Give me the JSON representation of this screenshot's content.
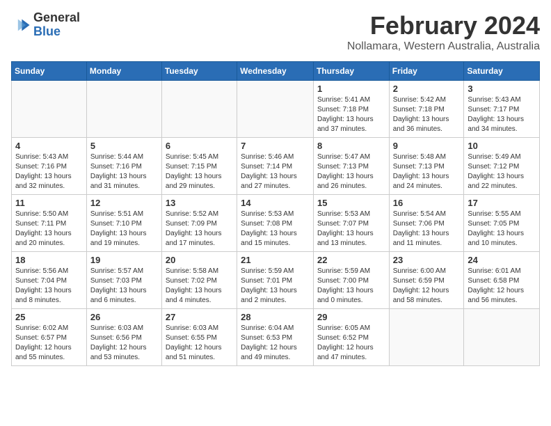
{
  "logo": {
    "general": "General",
    "blue": "Blue"
  },
  "title": "February 2024",
  "location": "Nollamara, Western Australia, Australia",
  "days_of_week": [
    "Sunday",
    "Monday",
    "Tuesday",
    "Wednesday",
    "Thursday",
    "Friday",
    "Saturday"
  ],
  "weeks": [
    [
      {
        "day": "",
        "info": ""
      },
      {
        "day": "",
        "info": ""
      },
      {
        "day": "",
        "info": ""
      },
      {
        "day": "",
        "info": ""
      },
      {
        "day": "1",
        "info": "Sunrise: 5:41 AM\nSunset: 7:18 PM\nDaylight: 13 hours\nand 37 minutes."
      },
      {
        "day": "2",
        "info": "Sunrise: 5:42 AM\nSunset: 7:18 PM\nDaylight: 13 hours\nand 36 minutes."
      },
      {
        "day": "3",
        "info": "Sunrise: 5:43 AM\nSunset: 7:17 PM\nDaylight: 13 hours\nand 34 minutes."
      }
    ],
    [
      {
        "day": "4",
        "info": "Sunrise: 5:43 AM\nSunset: 7:16 PM\nDaylight: 13 hours\nand 32 minutes."
      },
      {
        "day": "5",
        "info": "Sunrise: 5:44 AM\nSunset: 7:16 PM\nDaylight: 13 hours\nand 31 minutes."
      },
      {
        "day": "6",
        "info": "Sunrise: 5:45 AM\nSunset: 7:15 PM\nDaylight: 13 hours\nand 29 minutes."
      },
      {
        "day": "7",
        "info": "Sunrise: 5:46 AM\nSunset: 7:14 PM\nDaylight: 13 hours\nand 27 minutes."
      },
      {
        "day": "8",
        "info": "Sunrise: 5:47 AM\nSunset: 7:13 PM\nDaylight: 13 hours\nand 26 minutes."
      },
      {
        "day": "9",
        "info": "Sunrise: 5:48 AM\nSunset: 7:13 PM\nDaylight: 13 hours\nand 24 minutes."
      },
      {
        "day": "10",
        "info": "Sunrise: 5:49 AM\nSunset: 7:12 PM\nDaylight: 13 hours\nand 22 minutes."
      }
    ],
    [
      {
        "day": "11",
        "info": "Sunrise: 5:50 AM\nSunset: 7:11 PM\nDaylight: 13 hours\nand 20 minutes."
      },
      {
        "day": "12",
        "info": "Sunrise: 5:51 AM\nSunset: 7:10 PM\nDaylight: 13 hours\nand 19 minutes."
      },
      {
        "day": "13",
        "info": "Sunrise: 5:52 AM\nSunset: 7:09 PM\nDaylight: 13 hours\nand 17 minutes."
      },
      {
        "day": "14",
        "info": "Sunrise: 5:53 AM\nSunset: 7:08 PM\nDaylight: 13 hours\nand 15 minutes."
      },
      {
        "day": "15",
        "info": "Sunrise: 5:53 AM\nSunset: 7:07 PM\nDaylight: 13 hours\nand 13 minutes."
      },
      {
        "day": "16",
        "info": "Sunrise: 5:54 AM\nSunset: 7:06 PM\nDaylight: 13 hours\nand 11 minutes."
      },
      {
        "day": "17",
        "info": "Sunrise: 5:55 AM\nSunset: 7:05 PM\nDaylight: 13 hours\nand 10 minutes."
      }
    ],
    [
      {
        "day": "18",
        "info": "Sunrise: 5:56 AM\nSunset: 7:04 PM\nDaylight: 13 hours\nand 8 minutes."
      },
      {
        "day": "19",
        "info": "Sunrise: 5:57 AM\nSunset: 7:03 PM\nDaylight: 13 hours\nand 6 minutes."
      },
      {
        "day": "20",
        "info": "Sunrise: 5:58 AM\nSunset: 7:02 PM\nDaylight: 13 hours\nand 4 minutes."
      },
      {
        "day": "21",
        "info": "Sunrise: 5:59 AM\nSunset: 7:01 PM\nDaylight: 13 hours\nand 2 minutes."
      },
      {
        "day": "22",
        "info": "Sunrise: 5:59 AM\nSunset: 7:00 PM\nDaylight: 13 hours\nand 0 minutes."
      },
      {
        "day": "23",
        "info": "Sunrise: 6:00 AM\nSunset: 6:59 PM\nDaylight: 12 hours\nand 58 minutes."
      },
      {
        "day": "24",
        "info": "Sunrise: 6:01 AM\nSunset: 6:58 PM\nDaylight: 12 hours\nand 56 minutes."
      }
    ],
    [
      {
        "day": "25",
        "info": "Sunrise: 6:02 AM\nSunset: 6:57 PM\nDaylight: 12 hours\nand 55 minutes."
      },
      {
        "day": "26",
        "info": "Sunrise: 6:03 AM\nSunset: 6:56 PM\nDaylight: 12 hours\nand 53 minutes."
      },
      {
        "day": "27",
        "info": "Sunrise: 6:03 AM\nSunset: 6:55 PM\nDaylight: 12 hours\nand 51 minutes."
      },
      {
        "day": "28",
        "info": "Sunrise: 6:04 AM\nSunset: 6:53 PM\nDaylight: 12 hours\nand 49 minutes."
      },
      {
        "day": "29",
        "info": "Sunrise: 6:05 AM\nSunset: 6:52 PM\nDaylight: 12 hours\nand 47 minutes."
      },
      {
        "day": "",
        "info": ""
      },
      {
        "day": "",
        "info": ""
      }
    ]
  ]
}
